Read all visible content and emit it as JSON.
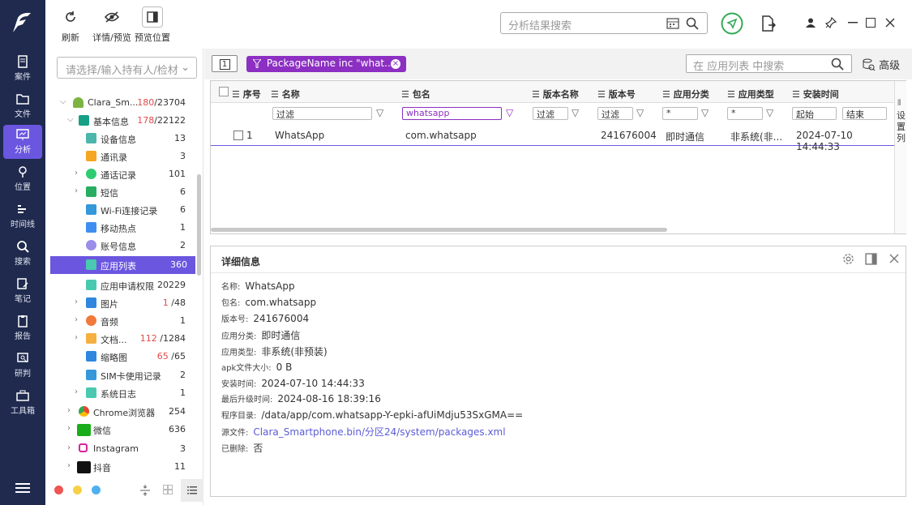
{
  "nav": {
    "items": [
      {
        "label": "案件",
        "icon": "case-icon"
      },
      {
        "label": "文件",
        "icon": "folder-icon"
      },
      {
        "label": "分析",
        "icon": "analysis-icon"
      },
      {
        "label": "位置",
        "icon": "location-icon"
      },
      {
        "label": "时间线",
        "icon": "timeline-icon"
      },
      {
        "label": "搜索",
        "icon": "search-icon"
      },
      {
        "label": "笔记",
        "icon": "note-icon"
      },
      {
        "label": "报告",
        "icon": "report-icon"
      },
      {
        "label": "研判",
        "icon": "judge-icon"
      },
      {
        "label": "工具箱",
        "icon": "toolbox-icon"
      }
    ]
  },
  "toolbar": {
    "refresh": "刷新",
    "detail_preview": "详情/预览",
    "preview_pos": "预览位置",
    "result_search_ph": "分析结果搜索"
  },
  "tree": {
    "owner_ph": "请选择/输入持有人/检材",
    "rows": [
      {
        "label": "Clara_Sm...",
        "red": "180",
        "count": "/23704"
      },
      {
        "label": "基本信息",
        "red": "178",
        "count": "/22122"
      },
      {
        "label": "设备信息",
        "count": "13"
      },
      {
        "label": "通讯录",
        "count": "3"
      },
      {
        "label": "通话记录",
        "count": "101"
      },
      {
        "label": "短信",
        "count": "6"
      },
      {
        "label": "Wi-Fi连接记录",
        "count": "6"
      },
      {
        "label": "移动热点",
        "count": "1"
      },
      {
        "label": "账号信息",
        "count": "2"
      },
      {
        "label": "应用列表",
        "count": "360"
      },
      {
        "label": "应用申请权限",
        "count": "20229"
      },
      {
        "label": "图片",
        "red": "1",
        "count": "/48"
      },
      {
        "label": "音频",
        "count": "1"
      },
      {
        "label": "文档...",
        "red": "112",
        "count": "/1284"
      },
      {
        "label": "缩略图",
        "red": "65",
        "count": "/65"
      },
      {
        "label": "SIM卡使用记录",
        "count": "2"
      },
      {
        "label": "系统日志",
        "count": "1"
      },
      {
        "label": "Chrome浏览器",
        "count": "254"
      },
      {
        "label": "微信",
        "count": "636"
      },
      {
        "label": "Instagram",
        "count": "3"
      },
      {
        "label": "抖音",
        "count": "11"
      }
    ]
  },
  "filter": {
    "chip": "PackageName inc \"what...",
    "search_ph": "在 应用列表 中搜索",
    "advanced": "高级",
    "one": "1"
  },
  "grid": {
    "headers": [
      "序号",
      "名称",
      "包名",
      "版本名称",
      "版本号",
      "应用分类",
      "应用类型",
      "安装时间"
    ],
    "filters": [
      "过滤",
      "whatsapp",
      "过滤",
      "过滤",
      "*",
      "*",
      "起始",
      "结束"
    ],
    "row": {
      "index": "1",
      "name": "WhatsApp",
      "package": "com.whatsapp",
      "version_code": "241676004",
      "category": "即时通信",
      "type": "非系统(非...",
      "install_time": "2024-07-10 14:44:33"
    },
    "settings_col": [
      "设",
      "置",
      "列"
    ]
  },
  "detail": {
    "title": "详细信息",
    "fields": [
      {
        "k": "名称:",
        "v": "WhatsApp"
      },
      {
        "k": "包名:",
        "v": "com.whatsapp"
      },
      {
        "k": "版本号:",
        "v": "241676004"
      },
      {
        "k": "应用分类:",
        "v": "即时通信"
      },
      {
        "k": "应用类型:",
        "v": "非系统(非预装)"
      },
      {
        "k": "apk文件大小:",
        "v": "0 B"
      },
      {
        "k": "安装时间:",
        "v": "2024-07-10 14:44:33"
      },
      {
        "k": "最后升级时间:",
        "v": "2024-08-16 18:39:16"
      },
      {
        "k": "程序目录:",
        "v": "/data/app/com.whatsapp-Y-epki-afUiMdju53SxGMA=="
      },
      {
        "k": "源文件:",
        "v": "Clara_Smartphone.bin/分区24/system/packages.xml"
      },
      {
        "k": "已删除:",
        "v": "否"
      }
    ]
  }
}
